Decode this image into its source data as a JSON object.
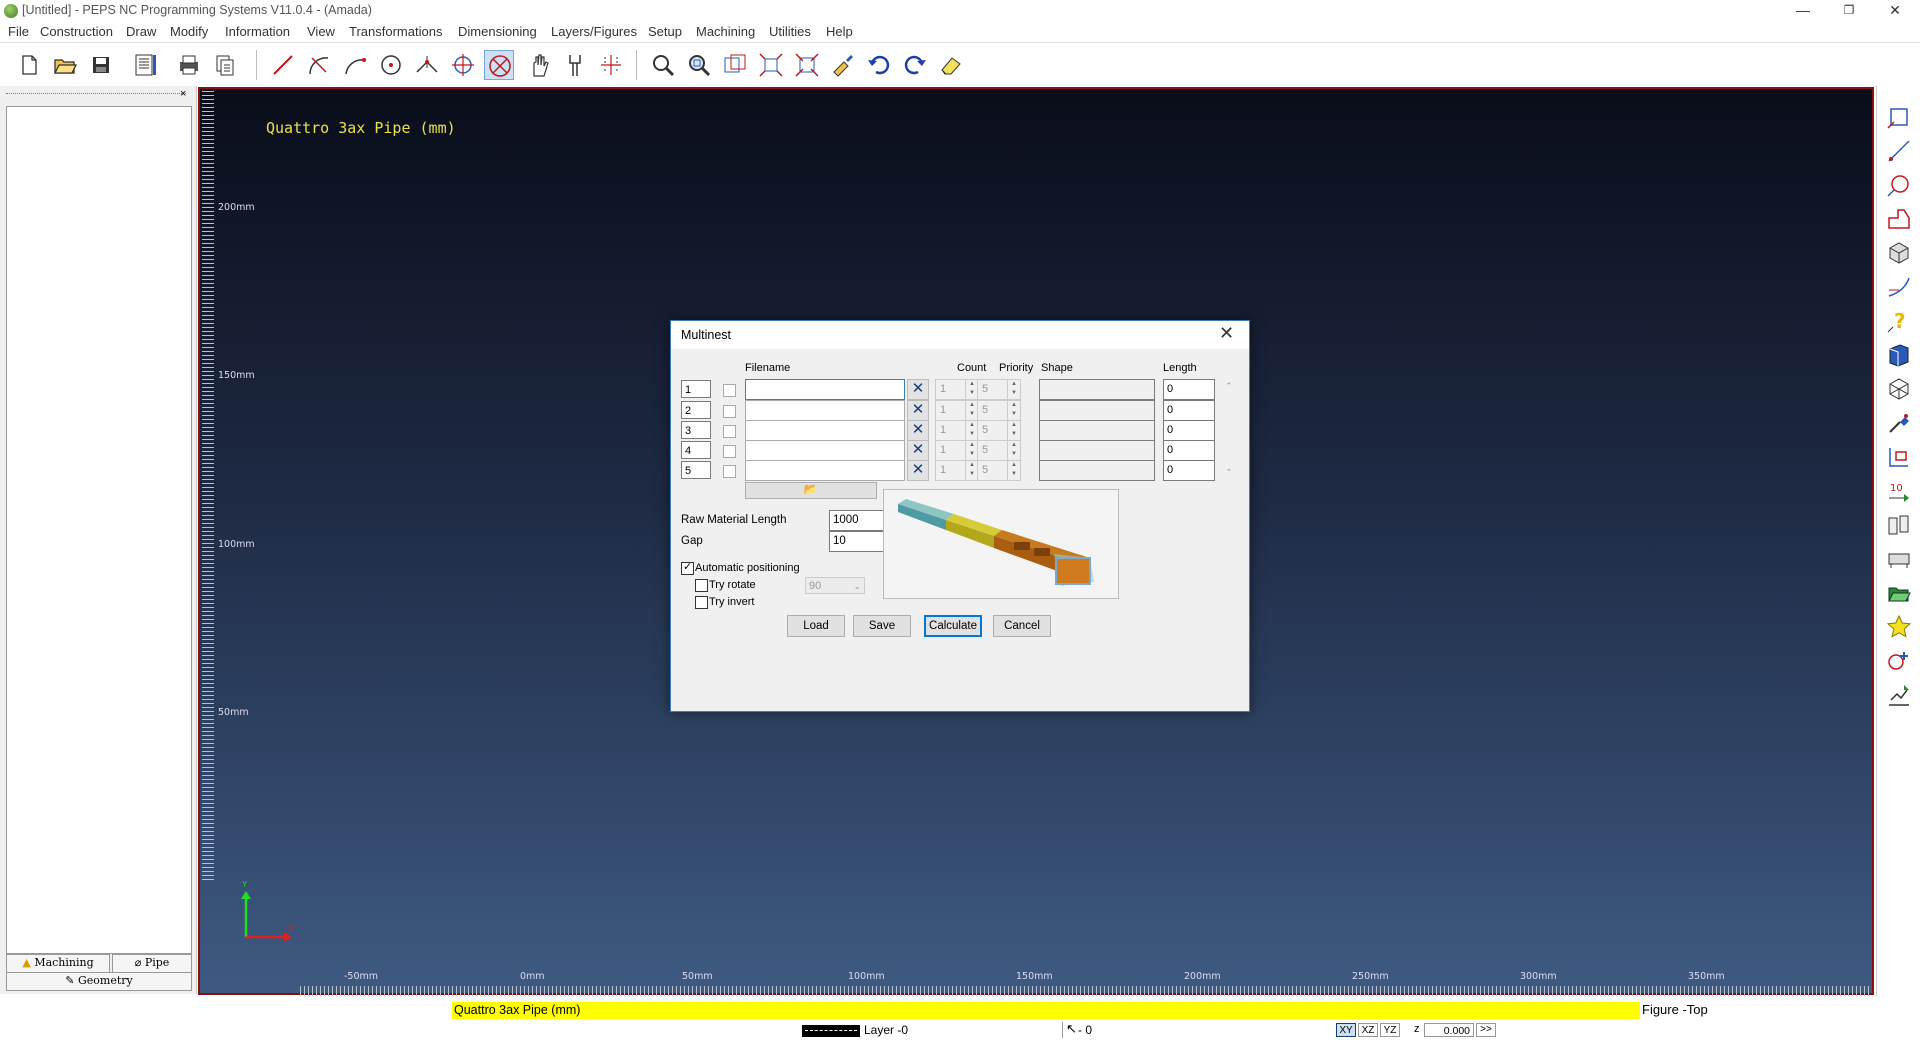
{
  "window": {
    "title": "[Untitled] - PEPS NC Programming Systems V11.0.4 - (Amada)",
    "minimize": "—",
    "restore": "❐",
    "close": "✕"
  },
  "menu": [
    "File",
    "Construction",
    "Draw",
    "Modify",
    "Information",
    "View",
    "Transformations",
    "Dimensioning",
    "Layers/Figures",
    "Setup",
    "Machining",
    "Utilities",
    "Help"
  ],
  "left_panel": {
    "close": "×",
    "tabs": {
      "machining": "Machining",
      "pipe": "Pipe",
      "geometry": "Geometry"
    }
  },
  "canvas": {
    "title": "Quattro 3ax Pipe (mm)",
    "y_labels": [
      "200mm",
      "150mm",
      "100mm",
      "50mm"
    ],
    "x_labels": [
      "-50mm",
      "0mm",
      "50mm",
      "100mm",
      "150mm",
      "200mm",
      "250mm",
      "300mm",
      "350mm"
    ],
    "axis_y": "Y",
    "axis_x": "X"
  },
  "dialog": {
    "title": "Multinest",
    "close": "✕",
    "headers": {
      "filename": "Filename",
      "count": "Count",
      "priority": "Priority",
      "shape": "Shape",
      "length": "Length"
    },
    "rows": [
      {
        "num": "1",
        "filename": "",
        "count": "1",
        "priority": "5",
        "shape": "",
        "length": "0"
      },
      {
        "num": "2",
        "filename": "",
        "count": "1",
        "priority": "5",
        "shape": "",
        "length": "0"
      },
      {
        "num": "3",
        "filename": "",
        "count": "1",
        "priority": "5",
        "shape": "",
        "length": "0"
      },
      {
        "num": "4",
        "filename": "",
        "count": "1",
        "priority": "5",
        "shape": "",
        "length": "0"
      },
      {
        "num": "5",
        "filename": "",
        "count": "1",
        "priority": "5",
        "shape": "",
        "length": "0"
      }
    ],
    "raw_material_label": "Raw Material Length",
    "raw_material_value": "1000",
    "gap_label": "Gap",
    "gap_value": "10",
    "auto_positioning_label": "Automatic positioning",
    "auto_positioning_checked": true,
    "try_rotate_label": "Try rotate",
    "try_rotate_value": "90",
    "try_invert_label": "Try invert",
    "buttons": {
      "load": "Load",
      "save": "Save",
      "calculate": "Calculate",
      "cancel": "Cancel"
    }
  },
  "status": {
    "figure_name": "Quattro 3ax Pipe (mm)",
    "figure_view": "Figure -Top",
    "layer": "Layer -0",
    "count": "- 0",
    "planes": [
      "XY",
      "XZ",
      "YZ"
    ],
    "z_label": "z",
    "z_value": "0.000",
    "more": ">>"
  },
  "colors": {
    "canvas_top": "#0a0d1a",
    "canvas_bottom": "#3e5a82",
    "canvas_border": "#8a1010",
    "cad_title": "#e8e24a",
    "status_highlight": "#ffff00",
    "dialog_accent": "#0078d7"
  }
}
